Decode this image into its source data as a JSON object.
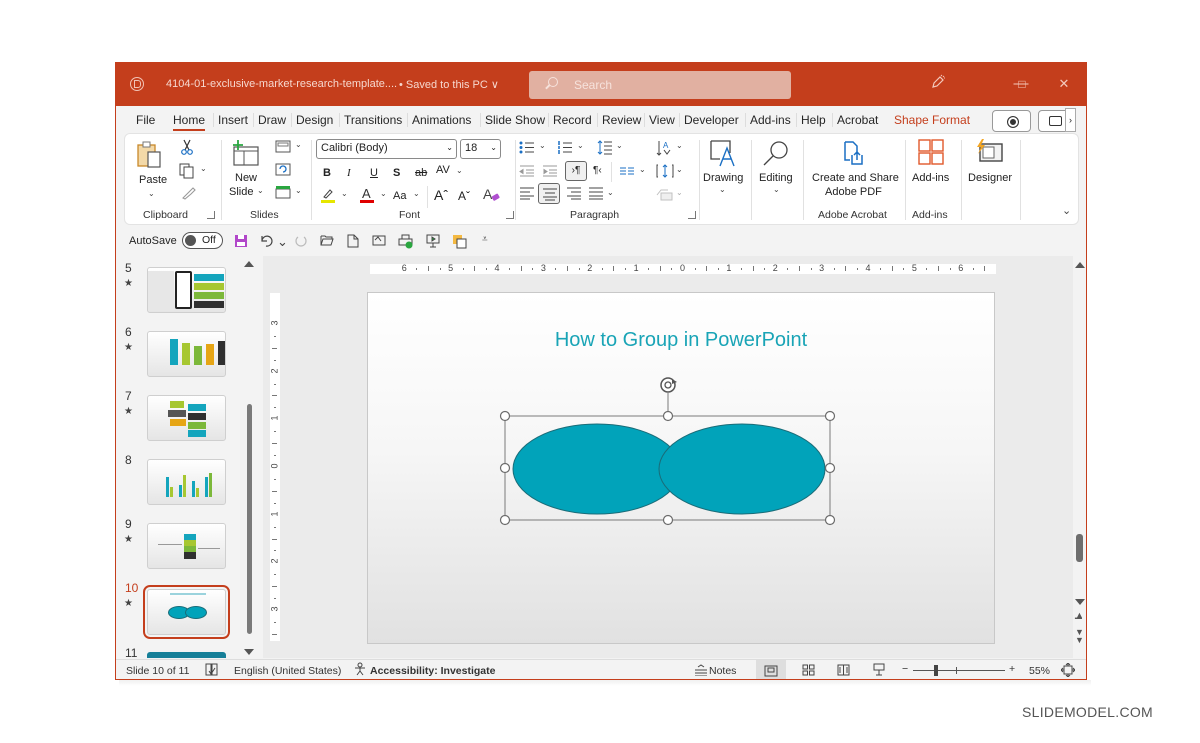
{
  "titlebar": {
    "filename": "4104-01-exclusive-market-research-template....",
    "save_status": "• Saved to this PC ∨",
    "search_placeholder": "Search",
    "buttons": {
      "minimize": "—",
      "maximize": "□",
      "close": "✕"
    }
  },
  "tabs": [
    {
      "label": "File"
    },
    {
      "label": "Home",
      "active": true
    },
    {
      "label": "Insert"
    },
    {
      "label": "Draw"
    },
    {
      "label": "Design"
    },
    {
      "label": "Transitions"
    },
    {
      "label": "Animations"
    },
    {
      "label": "Slide Show"
    },
    {
      "label": "Record"
    },
    {
      "label": "Review"
    },
    {
      "label": "View"
    },
    {
      "label": "Developer"
    },
    {
      "label": "Add-ins"
    },
    {
      "label": "Help"
    },
    {
      "label": "Acrobat"
    },
    {
      "label": "Shape Format",
      "contextual": true
    }
  ],
  "ribbon": {
    "clipboard": {
      "label": "Clipboard",
      "paste": "Paste"
    },
    "slides": {
      "label": "Slides",
      "new_slide_1": "New",
      "new_slide_2": "Slide"
    },
    "font": {
      "label": "Font",
      "font_name": "Calibri (Body)",
      "font_size": "18",
      "bold": "B",
      "italic": "I",
      "underline": "U",
      "shadow": "S",
      "strike": "ab",
      "spacing": "AV",
      "case": "Aa",
      "grow": "Aˆ",
      "shrink": "Aˇ",
      "clear": "A",
      "highlight_color": "#e6e600",
      "font_color": "#e00000"
    },
    "paragraph": {
      "label": "Paragraph"
    },
    "drawing": {
      "label": "Drawing"
    },
    "editing": {
      "label": "Editing"
    },
    "acrobat": {
      "label": "Adobe Acrobat",
      "button_line1": "Create and Share",
      "button_line2": "Adobe PDF"
    },
    "addins": {
      "label": "Add-ins",
      "button": "Add-ins"
    },
    "designer": {
      "button": "Designer"
    }
  },
  "qat": {
    "autosave_label": "AutoSave",
    "autosave_state": "Off"
  },
  "slides": [
    {
      "num": "5",
      "starred": true
    },
    {
      "num": "6",
      "starred": true
    },
    {
      "num": "7",
      "starred": true
    },
    {
      "num": "8",
      "starred": false
    },
    {
      "num": "9",
      "starred": true
    },
    {
      "num": "10",
      "starred": true,
      "current": true
    },
    {
      "num": "11",
      "starred": false
    }
  ],
  "star_glyph": "★",
  "hruler_labels": [
    "6",
    "5",
    "4",
    "3",
    "2",
    "1",
    "0",
    "1",
    "2",
    "3",
    "4",
    "5",
    "6"
  ],
  "vruler_labels": [
    "3",
    "2",
    "1",
    "0",
    "1",
    "2",
    "3"
  ],
  "slide": {
    "title": "How to Group in PowerPoint",
    "title_color": "#19a4b6",
    "shape_fill": "#01a3ba",
    "shape_stroke": "#1a6c78"
  },
  "status": {
    "slide_counter": "Slide 10 of 11",
    "language": "English (United States)",
    "accessibility": "Accessibility: Investigate",
    "notes": "Notes",
    "zoom": "55%",
    "zoom_minus": "−",
    "zoom_plus": "+"
  },
  "watermark": "SLIDEMODEL.COM"
}
